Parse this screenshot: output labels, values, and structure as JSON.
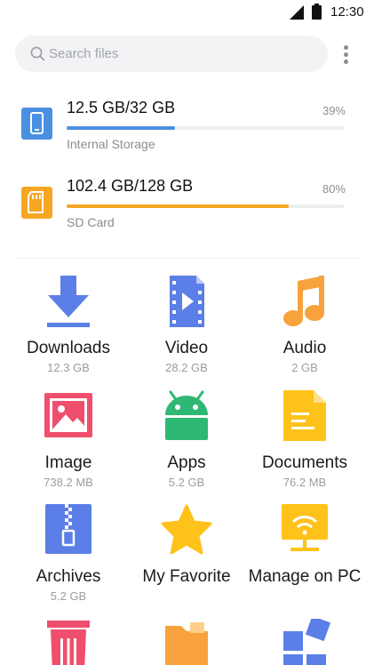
{
  "status_bar": {
    "time": "12:30"
  },
  "search": {
    "placeholder": "Search files"
  },
  "storage": [
    {
      "amount": "12.5 GB/32 GB",
      "label": "Internal Storage",
      "percent_text": "39%",
      "used_fraction": 0.39,
      "color": "#4a90e2"
    },
    {
      "amount": "102.4 GB/128 GB",
      "label": "SD Card",
      "percent_text": "80%",
      "used_fraction": 0.8,
      "color": "#f5a623"
    }
  ],
  "categories": [
    {
      "name": "Downloads",
      "size": "12.3 GB",
      "icon": "download-icon"
    },
    {
      "name": "Video",
      "size": "28.2 GB",
      "icon": "video-icon"
    },
    {
      "name": "Audio",
      "size": "2 GB",
      "icon": "music-note-icon"
    },
    {
      "name": "Image",
      "size": "738.2 MB",
      "icon": "image-icon"
    },
    {
      "name": "Apps",
      "size": "5.2 GB",
      "icon": "android-icon"
    },
    {
      "name": "Documents",
      "size": "76.2 MB",
      "icon": "document-icon"
    },
    {
      "name": "Archives",
      "size": "5.2 GB",
      "icon": "archive-zip-icon"
    },
    {
      "name": "My Favorite",
      "size": "",
      "icon": "star-icon"
    },
    {
      "name": "Manage on PC",
      "size": "",
      "icon": "monitor-wifi-icon"
    },
    {
      "name": "",
      "size": "",
      "icon": "trash-icon"
    },
    {
      "name": "",
      "size": "",
      "icon": "folder-icon"
    },
    {
      "name": "",
      "size": "",
      "icon": "widgets-icon"
    }
  ],
  "colors": {
    "blue": "#4a90e2",
    "orange": "#f5a623",
    "icon_blue": "#5b7fe6",
    "pink": "#ef4f6d",
    "green": "#2fb873",
    "yellow": "#ffc21a"
  }
}
